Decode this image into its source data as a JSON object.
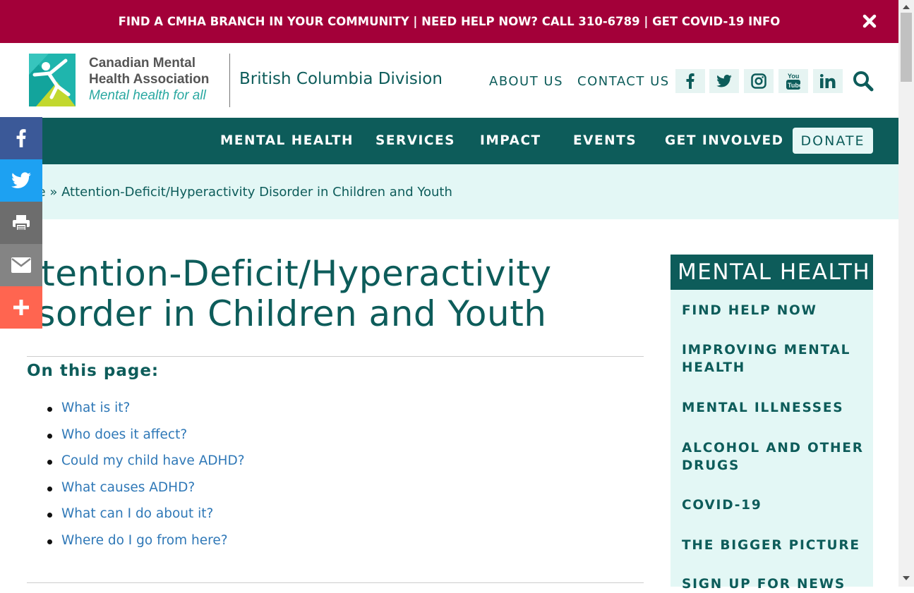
{
  "alert": {
    "text": "FIND A CMHA BRANCH IN YOUR COMMUNITY | NEED HELP NOW? CALL 310-6789 | GET COVID-19 INFO",
    "close_icon": "close-icon",
    "background": "#a30039"
  },
  "logo": {
    "line1": "Canadian Mental",
    "line2": "Health Association",
    "line3": "Mental health for all"
  },
  "header": {
    "division": "British Columbia Division",
    "links": [
      "ABOUT US",
      "CONTACT US"
    ],
    "social": [
      "facebook-icon",
      "twitter-icon",
      "instagram-icon",
      "youtube-icon",
      "linkedin-icon"
    ],
    "search_icon": "search-icon"
  },
  "nav": {
    "items": [
      "MENTAL HEALTH",
      "SERVICES",
      "IMPACT",
      "EVENTS",
      "GET INVOLVED"
    ],
    "donate": "DONATE",
    "background": "#0d5c5a"
  },
  "breadcrumb": {
    "text": "me » Attention-Deficit/Hyperactivity Disorder in Children and Youth"
  },
  "share_bar": [
    "facebook-icon",
    "twitter-icon",
    "print-icon",
    "email-icon",
    "plus-icon"
  ],
  "page": {
    "title_line1": "ttention-Deficit/Hyperactivity",
    "title_line2": "isorder in Children and Youth",
    "toc_heading": "On this page:",
    "toc": [
      "What is it?",
      "Who does it affect?",
      "Could my child have ADHD?",
      "What causes ADHD?",
      "What can I do about it?",
      "Where do I go from here?"
    ]
  },
  "sidebar": {
    "heading": "MENTAL HEALTH",
    "items": [
      "FIND HELP NOW",
      "IMPROVING MENTAL HEALTH",
      "MENTAL ILLNESSES",
      "ALCOHOL AND OTHER DRUGS",
      "COVID-19",
      "THE BIGGER PICTURE",
      "SIGN UP FOR NEWS"
    ]
  }
}
